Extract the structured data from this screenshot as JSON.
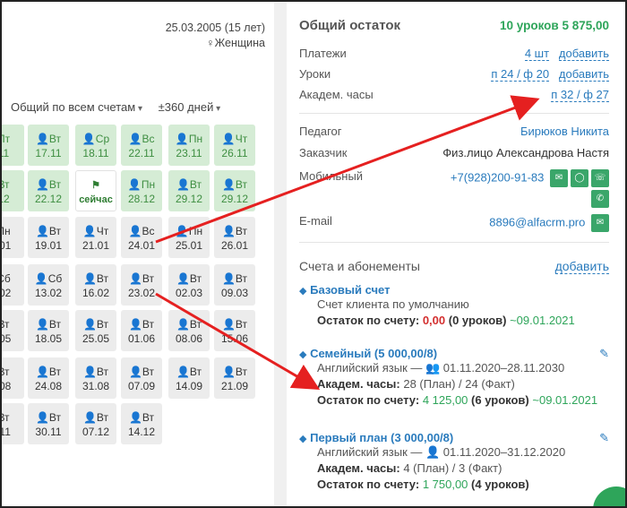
{
  "profile": {
    "birth": "25.03.2005 (15 лет)",
    "gender": "♀Женщина"
  },
  "filters": {
    "accounts": "Общий по всем счетам",
    "range": "±360 дней"
  },
  "lessons": [
    [
      "Пт",
      "11",
      "green"
    ],
    [
      "👤Вт",
      "17.11",
      "green"
    ],
    [
      "👤Ср",
      "18.11",
      "green"
    ],
    [
      "👤Вс",
      "22.11",
      "green"
    ],
    [
      "👤Пн",
      "23.11",
      "green"
    ],
    [
      "👤Чт",
      "26.11",
      "green"
    ],
    [
      "Вт",
      "12",
      "green"
    ],
    [
      "👤Вт",
      "22.12",
      "green"
    ],
    [
      "⚑",
      "сейчас",
      "now"
    ],
    [
      "👤Пн",
      "28.12",
      "green"
    ],
    [
      "👤Вт",
      "29.12",
      "green"
    ],
    [
      "👤Вт",
      "29.12",
      "green"
    ],
    [
      "Пн",
      ".01",
      "gray"
    ],
    [
      "👤Вт",
      "19.01",
      "gray"
    ],
    [
      "👤Чт",
      "21.01",
      "gray"
    ],
    [
      "👤Вс",
      "24.01",
      "gray"
    ],
    [
      "👤Пн",
      "25.01",
      "gray"
    ],
    [
      "👤Вт",
      "26.01",
      "gray"
    ],
    [
      "Сб",
      ".02",
      "gray"
    ],
    [
      "👤Сб",
      "13.02",
      "gray"
    ],
    [
      "👤Вт",
      "16.02",
      "gray"
    ],
    [
      "👤Вт",
      "23.02",
      "gray"
    ],
    [
      "👤Вт",
      "02.03",
      "gray"
    ],
    [
      "👤Вт",
      "09.03",
      "gray"
    ],
    [
      "Вт",
      ".05",
      "gray"
    ],
    [
      "👤Вт",
      "18.05",
      "gray"
    ],
    [
      "👤Вт",
      "25.05",
      "gray"
    ],
    [
      "👤Вт",
      "01.06",
      "gray"
    ],
    [
      "👤Вт",
      "08.06",
      "gray"
    ],
    [
      "👤Вт",
      "15.06",
      "gray"
    ],
    [
      "Вт",
      ".08",
      "gray"
    ],
    [
      "👤Вт",
      "24.08",
      "gray"
    ],
    [
      "👤Вт",
      "31.08",
      "gray"
    ],
    [
      "👤Вт",
      "07.09",
      "gray"
    ],
    [
      "👤Вт",
      "14.09",
      "gray"
    ],
    [
      "👤Вт",
      "21.09",
      "gray"
    ],
    [
      "Вт",
      ".11",
      "gray"
    ],
    [
      "👤Вт",
      "30.11",
      "gray"
    ],
    [
      "👤Вт",
      "07.12",
      "gray"
    ],
    [
      "👤Вт",
      "14.12",
      "gray"
    ]
  ],
  "balance": {
    "title": "Общий остаток",
    "total": "10 уроков    5 875,00",
    "payments_label": "Платежи",
    "payments_value": "4 шт",
    "payments_add": "добавить",
    "lessons_label": "Уроки",
    "lessons_value": "п 24 / ф 20",
    "lessons_add": "добавить",
    "hours_label": "Академ. часы",
    "hours_value": "п 32 / ф 27"
  },
  "contacts": {
    "teacher_label": "Педагог",
    "teacher_value": "Бирюков Никита",
    "customer_label": "Заказчик",
    "customer_value": "Физ.лицо Александрова Настя",
    "mobile_label": "Мобильный",
    "mobile_value": "+7(928)200-91-83",
    "email_label": "E-mail",
    "email_value": "8896@alfacrm.pro"
  },
  "accounts": {
    "title": "Счета и абонементы",
    "add": "добавить",
    "items": [
      {
        "name": "Базовый счет",
        "line1": "Счет клиента по умолчанию",
        "rest_label": "Остаток по счету:",
        "rest_sum": "0,00",
        "rest_lessons": "(0 уроков)",
        "rest_date": "~09.01.2021"
      },
      {
        "name": "Семейный (5 000,00/8)",
        "line1": "Английский язык — 👥 01.11.2020–28.11.2030",
        "hours_label": "Академ. часы:",
        "hours_value": "28 (План) / 24 (Факт)",
        "rest_label": "Остаток по счету:",
        "rest_sum": "4 125,00",
        "rest_lessons": "(6 уроков)",
        "rest_date": "~09.01.2021"
      },
      {
        "name": "Первый план (3 000,00/8)",
        "line1": "Английский язык — 👤 01.11.2020–31.12.2020",
        "hours_label": "Академ. часы:",
        "hours_value": "4 (План) / 3 (Факт)",
        "rest_label": "Остаток по счету:",
        "rest_sum": "1 750,00",
        "rest_lessons": "(4 уроков)"
      }
    ]
  }
}
